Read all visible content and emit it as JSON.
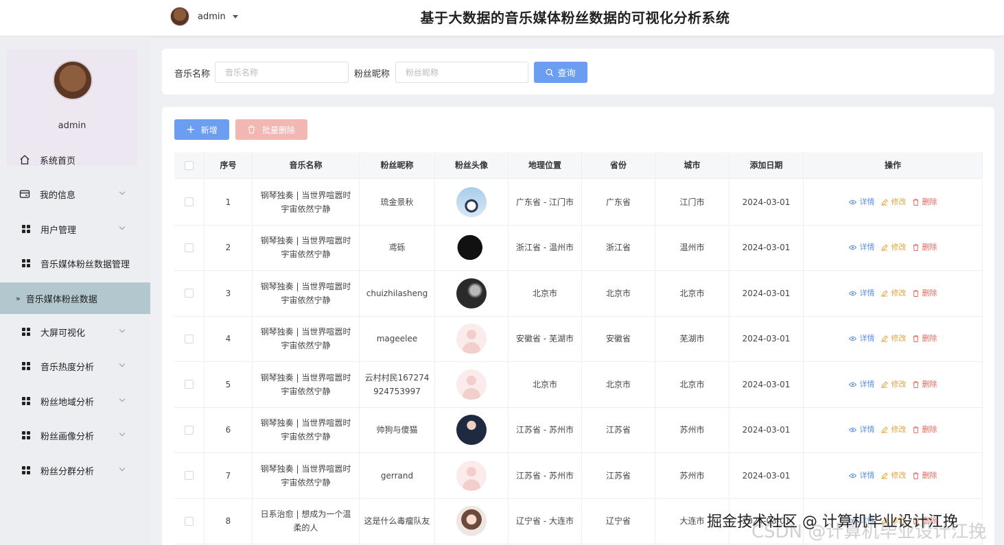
{
  "header": {
    "username": "admin",
    "title": "基于大数据的音乐媒体粉丝数据的可视化分析系统"
  },
  "sidebar": {
    "profile_name": "admin",
    "items": [
      {
        "label": "系统首页",
        "icon": "home-icon"
      },
      {
        "label": "我的信息",
        "icon": "card-icon"
      },
      {
        "label": "用户管理",
        "icon": "grid-icon"
      },
      {
        "label": "音乐媒体粉丝数据管理",
        "icon": "grid-icon"
      },
      {
        "label": "音乐媒体粉丝数据",
        "icon": "arrow-icon",
        "active": true
      },
      {
        "label": "大屏可视化",
        "icon": "grid-icon"
      },
      {
        "label": "音乐热度分析",
        "icon": "grid-icon"
      },
      {
        "label": "粉丝地域分析",
        "icon": "grid-icon"
      },
      {
        "label": "粉丝画像分析",
        "icon": "grid-icon"
      },
      {
        "label": "粉丝分群分析",
        "icon": "grid-icon"
      }
    ]
  },
  "search": {
    "music_label": "音乐名称",
    "music_placeholder": "音乐名称",
    "fan_label": "粉丝昵称",
    "fan_placeholder": "粉丝昵称",
    "search_button": "查询"
  },
  "toolbar": {
    "add_label": "新增",
    "batch_delete_label": "批量删除"
  },
  "table": {
    "columns": [
      "序号",
      "音乐名称",
      "粉丝昵称",
      "粉丝头像",
      "地理位置",
      "省份",
      "城市",
      "添加日期",
      "操作"
    ],
    "actions": {
      "detail": "详情",
      "edit": "修改",
      "delete": "删除"
    },
    "rows": [
      {
        "no": "1",
        "music": "钢琴独奏 | 当世界喧嚣时宇宙依然宁静",
        "fan": "琉金景秋",
        "avatar": "penguin",
        "location": "广东省 - 江门市",
        "province": "广东省",
        "city": "江门市",
        "date": "2024-03-01"
      },
      {
        "no": "2",
        "music": "钢琴独奏 | 当世界喧嚣时宇宙依然宁静",
        "fan": "鸢砾",
        "avatar": "ink",
        "location": "浙江省 - 温州市",
        "province": "浙江省",
        "city": "温州市",
        "date": "2024-03-01"
      },
      {
        "no": "3",
        "music": "钢琴独奏 | 当世界喧嚣时宇宙依然宁静",
        "fan": "chuizhilasheng",
        "avatar": "dark",
        "location": "北京市",
        "province": "北京市",
        "city": "北京市",
        "date": "2024-03-01"
      },
      {
        "no": "4",
        "music": "钢琴独奏 | 当世界喧嚣时宇宙依然宁静",
        "fan": "mageelee",
        "avatar": "default",
        "location": "安徽省 - 芜湖市",
        "province": "安徽省",
        "city": "芜湖市",
        "date": "2024-03-01"
      },
      {
        "no": "5",
        "music": "钢琴独奏 | 当世界喧嚣时宇宙依然宁静",
        "fan": "云村村民167274924753997",
        "avatar": "default",
        "location": "北京市",
        "province": "北京市",
        "city": "北京市",
        "date": "2024-03-01"
      },
      {
        "no": "6",
        "music": "钢琴独奏 | 当世界喧嚣时宇宙依然宁静",
        "fan": "帅狗与傻猫",
        "avatar": "anime",
        "location": "江苏省 - 苏州市",
        "province": "江苏省",
        "city": "苏州市",
        "date": "2024-03-01"
      },
      {
        "no": "7",
        "music": "钢琴独奏 | 当世界喧嚣时宇宙依然宁静",
        "fan": "gerrand",
        "avatar": "default",
        "location": "江苏省 - 苏州市",
        "province": "江苏省",
        "city": "苏州市",
        "date": "2024-03-01"
      },
      {
        "no": "8",
        "music": "日系治愈 | 想成为一个温柔的人",
        "fan": "这是什么毒瘤队友",
        "avatar": "girl",
        "location": "辽宁省 - 大连市",
        "province": "辽宁省",
        "city": "大连市",
        "date": "2024-03-01"
      }
    ]
  },
  "watermark": {
    "primary": "掘金技术社区 @ 计算机毕业设计江挽",
    "secondary": "CSDN @计算机毕业设计江挽"
  },
  "colors": {
    "primary": "#6b9ef0",
    "danger_light": "#f3b7b3",
    "active_menu": "#b3c7cf",
    "detail": "#5b8fe0",
    "edit": "#e0a43a",
    "delete": "#e06a5f"
  }
}
